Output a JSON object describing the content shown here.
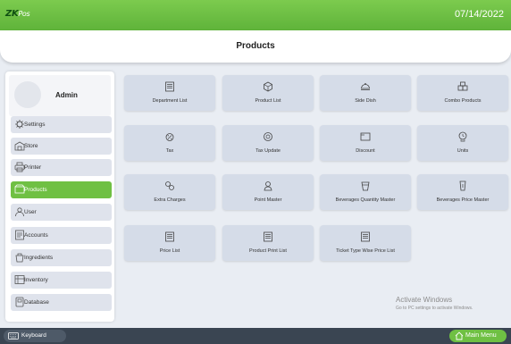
{
  "header": {
    "logo_zk": "ZK",
    "logo_pos": "Pos",
    "date": "07/14/2022",
    "page_title": "Products"
  },
  "sidebar": {
    "user_name": "Admin",
    "items": [
      {
        "label": "Settings",
        "icon": "settings-icon",
        "active": false
      },
      {
        "label": "Store",
        "icon": "store-icon",
        "active": false
      },
      {
        "label": "Printer",
        "icon": "printer-icon",
        "active": false
      },
      {
        "label": "Products",
        "icon": "products-icon",
        "active": true
      },
      {
        "label": "User",
        "icon": "user-icon",
        "active": false
      },
      {
        "label": "Accounts",
        "icon": "accounts-icon",
        "active": false
      },
      {
        "label": "Ingredients",
        "icon": "ingredients-icon",
        "active": false
      },
      {
        "label": "Inventory",
        "icon": "inventory-icon",
        "active": false
      },
      {
        "label": "Database",
        "icon": "database-icon",
        "active": false
      }
    ]
  },
  "tiles": [
    {
      "label": "Department List",
      "icon": "list-icon"
    },
    {
      "label": "Product List",
      "icon": "cube-icon"
    },
    {
      "label": "Side Dish",
      "icon": "dish-icon"
    },
    {
      "label": "Combo Products",
      "icon": "combo-icon"
    },
    {
      "label": "Tax",
      "icon": "tax-icon"
    },
    {
      "label": "Tax Update",
      "icon": "tax-update-icon"
    },
    {
      "label": "Discount",
      "icon": "discount-icon"
    },
    {
      "label": "Units",
      "icon": "units-icon"
    },
    {
      "label": "Extra Charges",
      "icon": "extra-charges-icon"
    },
    {
      "label": "Point Master",
      "icon": "point-master-icon"
    },
    {
      "label": "Beverages Quantity Master",
      "icon": "beverages-quantity-icon"
    },
    {
      "label": "Beverages Price Master",
      "icon": "beverages-price-icon"
    },
    {
      "label": "Price List",
      "icon": "price-list-icon"
    },
    {
      "label": "Product Print List",
      "icon": "print-list-icon"
    },
    {
      "label": "Ticket Type Wise Price List",
      "icon": "ticket-price-icon"
    }
  ],
  "watermark": {
    "line1": "Activate Windows",
    "line2": "Go to PC settings to activate Windows."
  },
  "footer": {
    "keyboard_label": "Keyboard",
    "main_menu_label": "Main Menu"
  },
  "colors": {
    "accent_green": "#6fc043",
    "tile_bg": "#d5dce8",
    "footer_bg": "#3a4552"
  }
}
